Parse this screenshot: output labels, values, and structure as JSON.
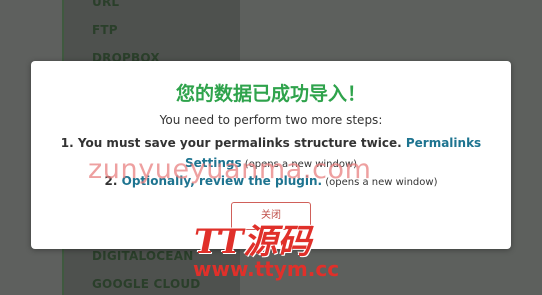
{
  "background": {
    "items_top": [
      "URL",
      "FTP",
      "DROPBOX"
    ],
    "items_bottom": [
      "DIGITALOCEAN",
      "GOOGLE CLOUD"
    ]
  },
  "modal": {
    "title": "您的数据已成功导入！",
    "intro": "You need to perform two more steps:",
    "step1_prefix": "1. You must save your permalinks structure twice. ",
    "step1_link": "Permalinks Settings",
    "step1_note": " (opens a new window)",
    "step2_prefix": "2. ",
    "step2_link": "Optionally, review the plugin.",
    "step2_note": " (opens a new window)",
    "close_label": "关闭"
  },
  "watermark": {
    "url_pinyin": "zunyueyuanma.com",
    "brand": "TT源码",
    "url": "www.ttym.cc"
  },
  "colors": {
    "title_green": "#2fa34c",
    "link_blue": "#1e7490",
    "close_red": "#c0504a",
    "watermark_red": "#e0302a"
  }
}
